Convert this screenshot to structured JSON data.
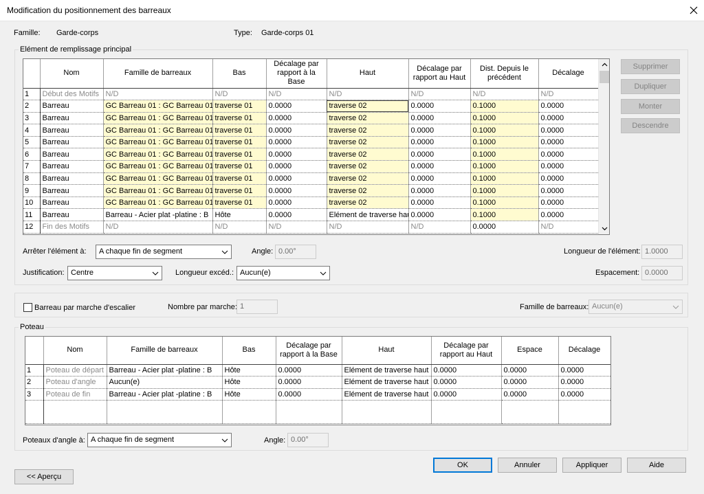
{
  "window": {
    "title": "Modification du positionnement des barreaux"
  },
  "header": {
    "famille_label": "Famille:",
    "famille_value": "Garde-corps",
    "type_label": "Type:",
    "type_value": "Garde-corps 01"
  },
  "main_group": {
    "legend": "Elément de remplissage principal",
    "columns": [
      "Nom",
      "Famille de barreaux",
      "Bas",
      "Décalage par rapport à la Base",
      "Haut",
      "Décalage par rapport au Haut",
      "Dist. Depuis le précédent",
      "Décalage"
    ],
    "rows": [
      {
        "n": "1",
        "nom": "Début des Motifs",
        "famille": "N/D",
        "bas": "N/D",
        "dbase": "N/D",
        "haut": "N/D",
        "dhaut": "N/D",
        "dist": "N/D",
        "dec": "N/D"
      },
      {
        "n": "2",
        "nom": "Barreau",
        "famille": "GC Barreau 01 : GC Barreau 01",
        "bas": "traverse 01",
        "dbase": "0.0000",
        "haut": "traverse 02",
        "dhaut": "0.0000",
        "dist": "0.1000",
        "dec": "0.0000"
      },
      {
        "n": "3",
        "nom": "Barreau",
        "famille": "GC Barreau 01 : GC Barreau 01",
        "bas": "traverse 01",
        "dbase": "0.0000",
        "haut": "traverse 02",
        "dhaut": "0.0000",
        "dist": "0.1000",
        "dec": "0.0000"
      },
      {
        "n": "4",
        "nom": "Barreau",
        "famille": "GC Barreau 01 : GC Barreau 01",
        "bas": "traverse 01",
        "dbase": "0.0000",
        "haut": "traverse 02",
        "dhaut": "0.0000",
        "dist": "0.1000",
        "dec": "0.0000"
      },
      {
        "n": "5",
        "nom": "Barreau",
        "famille": "GC Barreau 01 : GC Barreau 01",
        "bas": "traverse 01",
        "dbase": "0.0000",
        "haut": "traverse 02",
        "dhaut": "0.0000",
        "dist": "0.1000",
        "dec": "0.0000"
      },
      {
        "n": "6",
        "nom": "Barreau",
        "famille": "GC Barreau 01 : GC Barreau 01",
        "bas": "traverse 01",
        "dbase": "0.0000",
        "haut": "traverse 02",
        "dhaut": "0.0000",
        "dist": "0.1000",
        "dec": "0.0000"
      },
      {
        "n": "7",
        "nom": "Barreau",
        "famille": "GC Barreau 01 : GC Barreau 01",
        "bas": "traverse 01",
        "dbase": "0.0000",
        "haut": "traverse 02",
        "dhaut": "0.0000",
        "dist": "0.1000",
        "dec": "0.0000"
      },
      {
        "n": "8",
        "nom": "Barreau",
        "famille": "GC Barreau 01 : GC Barreau 01",
        "bas": "traverse 01",
        "dbase": "0.0000",
        "haut": "traverse 02",
        "dhaut": "0.0000",
        "dist": "0.1000",
        "dec": "0.0000"
      },
      {
        "n": "9",
        "nom": "Barreau",
        "famille": "GC Barreau 01 : GC Barreau 01",
        "bas": "traverse 01",
        "dbase": "0.0000",
        "haut": "traverse 02",
        "dhaut": "0.0000",
        "dist": "0.1000",
        "dec": "0.0000"
      },
      {
        "n": "10",
        "nom": "Barreau",
        "famille": "GC Barreau 01 : GC Barreau 01",
        "bas": "traverse 01",
        "dbase": "0.0000",
        "haut": "traverse 02",
        "dhaut": "0.0000",
        "dist": "0.1000",
        "dec": "0.0000"
      },
      {
        "n": "11",
        "nom": "Barreau",
        "famille": "Barreau - Acier plat -platine : B",
        "bas": "Hôte",
        "dbase": "0.0000",
        "haut": "Elément de traverse haut",
        "dhaut": "0.0000",
        "dist": "0.1000",
        "dec": "0.0000"
      },
      {
        "n": "12",
        "nom": "Fin des Motifs",
        "famille": "N/D",
        "bas": "N/D",
        "dbase": "N/D",
        "haut": "N/D",
        "dhaut": "N/D",
        "dist": "0.0000",
        "dec": "N/D"
      }
    ],
    "buttons": {
      "supprimer": "Supprimer",
      "dupliquer": "Dupliquer",
      "monter": "Monter",
      "descendre": "Descendre"
    },
    "arreter_label": "Arrêter l'élément à:",
    "arreter_value": "A chaque fin de segment",
    "angle_label": "Angle:",
    "angle_value": "0.00°",
    "longueur_label": "Longueur de l'élément:",
    "longueur_value": "1.0000",
    "justification_label": "Justification:",
    "justification_value": "Centre",
    "longueur_exced_label": "Longueur excéd.:",
    "longueur_exced_value": "Aucun(e)",
    "espacement_label": "Espacement:",
    "espacement_value": "0.0000"
  },
  "stair": {
    "checkbox_label": "Barreau par marche d'escalier",
    "nombre_label": "Nombre par marche:",
    "nombre_value": "1",
    "famille_label": "Famille de barreaux:",
    "famille_value": "Aucun(e)"
  },
  "poteau": {
    "legend": "Poteau",
    "columns": [
      "Nom",
      "Famille de barreaux",
      "Bas",
      "Décalage par rapport à la Base",
      "Haut",
      "Décalage par rapport au Haut",
      "Espace",
      "Décalage"
    ],
    "rows": [
      {
        "n": "1",
        "nom": "Poteau de départ",
        "famille": "Barreau - Acier plat -platine : B",
        "bas": "Hôte",
        "dbase": "0.0000",
        "haut": "Elément de traverse haut",
        "dhaut": "0.0000",
        "espace": "0.0000",
        "dec": "0.0000"
      },
      {
        "n": "2",
        "nom": "Poteau d'angle",
        "famille": "Aucun(e)",
        "bas": "Hôte",
        "dbase": "0.0000",
        "haut": "Elément de traverse haut",
        "dhaut": "0.0000",
        "espace": "0.0000",
        "dec": "0.0000"
      },
      {
        "n": "3",
        "nom": "Poteau de fin",
        "famille": "Barreau - Acier plat -platine : B",
        "bas": "Hôte",
        "dbase": "0.0000",
        "haut": "Elément de traverse haut",
        "dhaut": "0.0000",
        "espace": "0.0000",
        "dec": "0.0000"
      }
    ],
    "angle_poteaux_label": "Poteaux d'angle à:",
    "angle_poteaux_value": "A chaque fin de segment",
    "angle_label": "Angle:",
    "angle_value": "0.00°"
  },
  "footer": {
    "ok": "OK",
    "annuler": "Annuler",
    "appliquer": "Appliquer",
    "aide": "Aide",
    "apercu": "<< Aperçu"
  },
  "colors": {
    "highlight": "#fffbd0",
    "accent": "#0078d7",
    "gray_text": "#8a8a8a"
  }
}
